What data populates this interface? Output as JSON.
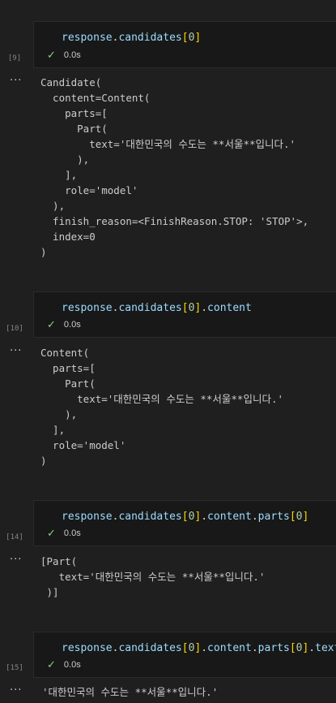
{
  "cells": [
    {
      "exec_count": "[9]",
      "code_tokens": [
        {
          "t": "response",
          "c": "id"
        },
        {
          "t": ".",
          "c": "dot"
        },
        {
          "t": "candidates",
          "c": "id"
        },
        {
          "t": "[",
          "c": "br"
        },
        {
          "t": "0",
          "c": "num"
        },
        {
          "t": "]",
          "c": "br"
        }
      ],
      "status_time": "0.0s",
      "more": "···",
      "output": "Candidate(\n  content=Content(\n    parts=[\n      Part(\n        text='대한민국의 수도는 **서울**입니다.'\n      ),\n    ],\n    role='model'\n  ),\n  finish_reason=<FinishReason.STOP: 'STOP'>,\n  index=0\n)"
    },
    {
      "exec_count": "[10]",
      "code_tokens": [
        {
          "t": "response",
          "c": "id"
        },
        {
          "t": ".",
          "c": "dot"
        },
        {
          "t": "candidates",
          "c": "id"
        },
        {
          "t": "[",
          "c": "br"
        },
        {
          "t": "0",
          "c": "num"
        },
        {
          "t": "]",
          "c": "br"
        },
        {
          "t": ".",
          "c": "dot"
        },
        {
          "t": "content",
          "c": "id"
        }
      ],
      "status_time": "0.0s",
      "more": "···",
      "output": "Content(\n  parts=[\n    Part(\n      text='대한민국의 수도는 **서울**입니다.'\n    ),\n  ],\n  role='model'\n)"
    },
    {
      "exec_count": "[14]",
      "code_tokens": [
        {
          "t": "response",
          "c": "id"
        },
        {
          "t": ".",
          "c": "dot"
        },
        {
          "t": "candidates",
          "c": "id"
        },
        {
          "t": "[",
          "c": "br"
        },
        {
          "t": "0",
          "c": "num"
        },
        {
          "t": "]",
          "c": "br"
        },
        {
          "t": ".",
          "c": "dot"
        },
        {
          "t": "content",
          "c": "id"
        },
        {
          "t": ".",
          "c": "dot"
        },
        {
          "t": "parts",
          "c": "id"
        },
        {
          "t": "[",
          "c": "br"
        },
        {
          "t": "0",
          "c": "num"
        },
        {
          "t": "]",
          "c": "br"
        }
      ],
      "status_time": "0.0s",
      "more": "···",
      "output": "[Part(\n   text='대한민국의 수도는 **서울**입니다.'\n )]"
    },
    {
      "exec_count": "[15]",
      "code_tokens": [
        {
          "t": "response",
          "c": "id"
        },
        {
          "t": ".",
          "c": "dot"
        },
        {
          "t": "candidates",
          "c": "id"
        },
        {
          "t": "[",
          "c": "br"
        },
        {
          "t": "0",
          "c": "num"
        },
        {
          "t": "]",
          "c": "br"
        },
        {
          "t": ".",
          "c": "dot"
        },
        {
          "t": "content",
          "c": "id"
        },
        {
          "t": ".",
          "c": "dot"
        },
        {
          "t": "parts",
          "c": "id"
        },
        {
          "t": "[",
          "c": "br"
        },
        {
          "t": "0",
          "c": "num"
        },
        {
          "t": "]",
          "c": "br"
        },
        {
          "t": ".",
          "c": "dot"
        },
        {
          "t": "text",
          "c": "id"
        }
      ],
      "status_time": "0.0s",
      "more": "···",
      "output": "'대한민국의 수도는 **서울**입니다.'"
    }
  ],
  "colors": {
    "background": "#1f1f1f",
    "cell_background": "#181818",
    "identifier": "#9cdcfe",
    "bracket": "#ffd700",
    "number": "#b5cea8",
    "check": "#89d185",
    "output_text": "#cccccc"
  },
  "icons": {
    "status": "check-icon",
    "output_toggle": "more-icon"
  }
}
